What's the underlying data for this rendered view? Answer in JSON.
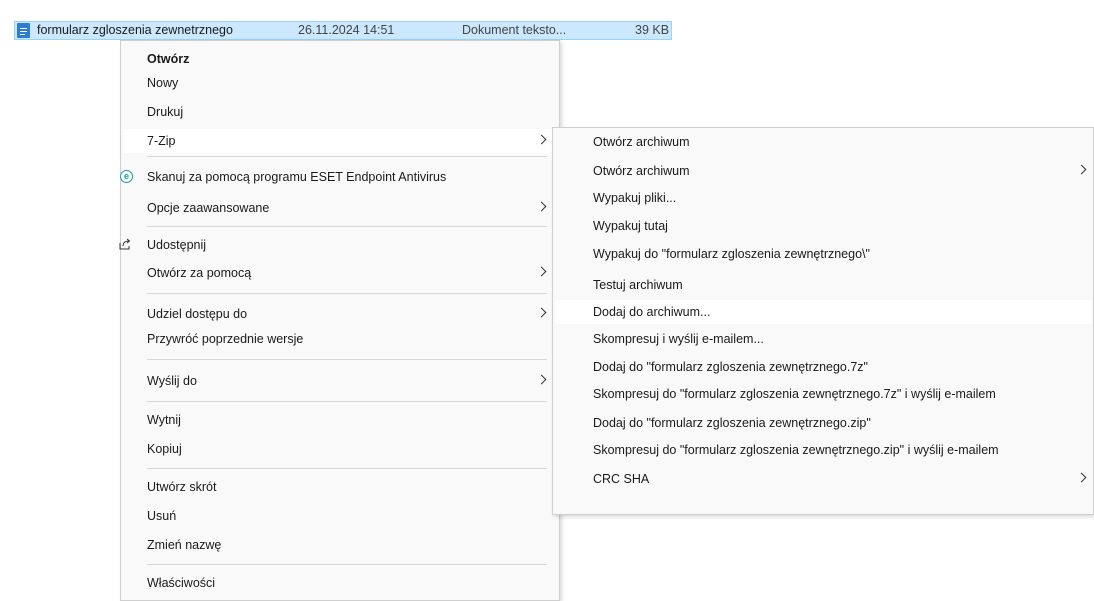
{
  "file": {
    "name": "formularz zgloszenia zewnetrznego",
    "date": "26.11.2024 14:51",
    "type": "Dokument teksto...",
    "size": "39 KB"
  },
  "main_menu": {
    "open": "Otwórz",
    "new": "Nowy",
    "print": "Drukuj",
    "zip": "7-Zip",
    "eset_scan": "Skanuj za pomocą programu ESET Endpoint Antivirus",
    "advanced": "Opcje zaawansowane",
    "share": "Udostępnij",
    "open_with": "Otwórz za pomocą",
    "give_access": "Udziel dostępu do",
    "restore": "Przywróć poprzednie wersje",
    "send_to": "Wyślij do",
    "cut": "Wytnij",
    "copy": "Kopiuj",
    "create_shortcut": "Utwórz skrót",
    "delete": "Usuń",
    "rename": "Zmień nazwę",
    "properties": "Właściwości"
  },
  "zip_menu": {
    "open_archive": "Otwórz archiwum",
    "open_archive_sub": "Otwórz archiwum",
    "extract_files": "Wypakuj pliki...",
    "extract_here": "Wypakuj tutaj",
    "extract_to": "Wypakuj do \"formularz zgloszenia zewnętrznego\\\"",
    "test_archive": "Testuj archiwum",
    "add_to_archive": "Dodaj do archiwum...",
    "compress_email": "Skompresuj i wyślij e-mailem...",
    "add_to_7z": "Dodaj do \"formularz zgloszenia zewnętrznego.7z\"",
    "compress_7z_email": "Skompresuj do \"formularz zgloszenia zewnętrznego.7z\" i wyślij e-mailem",
    "add_to_zip": "Dodaj do \"formularz zgloszenia zewnętrznego.zip\"",
    "compress_zip_email": "Skompresuj do \"formularz zgloszenia zewnętrznego.zip\" i wyślij e-mailem",
    "crc_sha": "CRC SHA"
  },
  "icons": {
    "file": "document-icon",
    "eset": "eset-icon",
    "share": "share-icon",
    "submenu": "chevron-right-icon"
  },
  "colors": {
    "selection": "#cce8ff",
    "selection_border": "#99d1ff",
    "menu_bg": "#f9f9f9",
    "highlight": "#ffffff"
  }
}
